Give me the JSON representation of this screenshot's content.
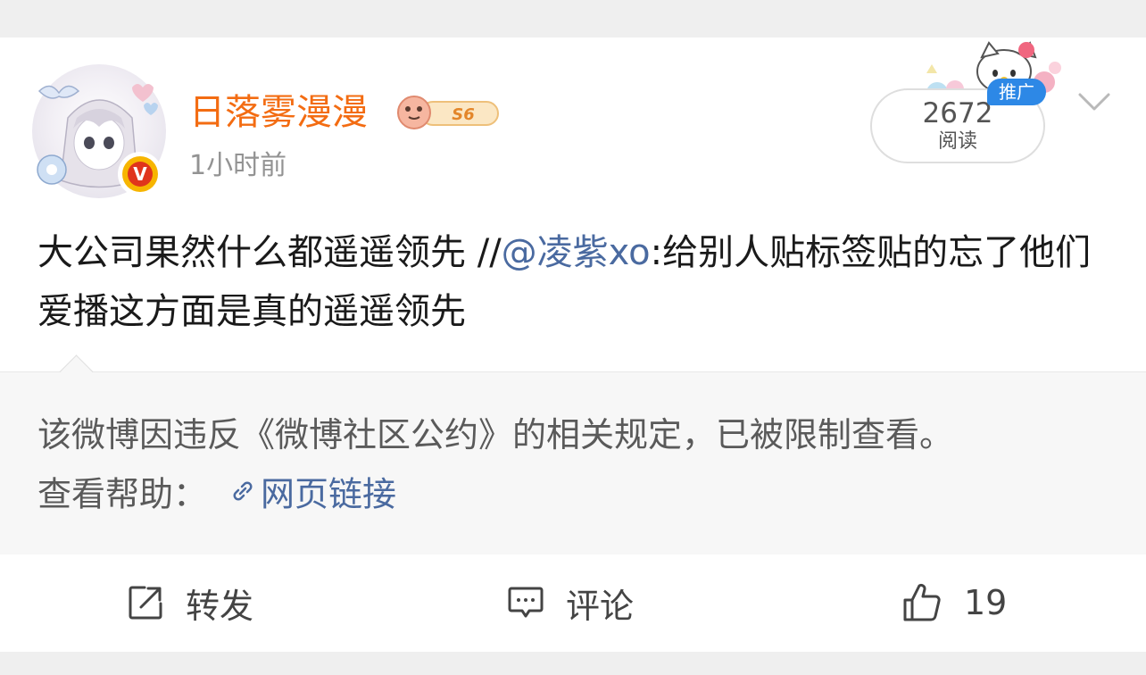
{
  "post": {
    "author": {
      "name": "日落雾漫漫",
      "level_badge": "S6",
      "verified_mark": "V"
    },
    "time": "1小时前",
    "read_count": "2672",
    "read_label": "阅读",
    "promo_tag": "推广",
    "text_main": "大公司果然什么都遥遥领先 //",
    "mention": "@凌紫xo",
    "text_rest": ":给别人贴标签贴的忘了他们爱播这方面是真的遥遥领先"
  },
  "restricted": {
    "notice": "该微博因违反《微博社区公约》的相关规定，已被限制查看。",
    "help_label": "查看帮助：",
    "link_text": "网页链接"
  },
  "actions": {
    "repost_label": "转发",
    "comment_label": "评论",
    "like_count": "19"
  },
  "colors": {
    "username": "#f36c12",
    "mention": "#4a6aa0",
    "promo_tag": "#2d88e6",
    "verified": "#e0341c"
  },
  "icons": [
    "chevron-down-icon",
    "link-icon",
    "repost-icon",
    "comment-icon",
    "like-icon"
  ]
}
